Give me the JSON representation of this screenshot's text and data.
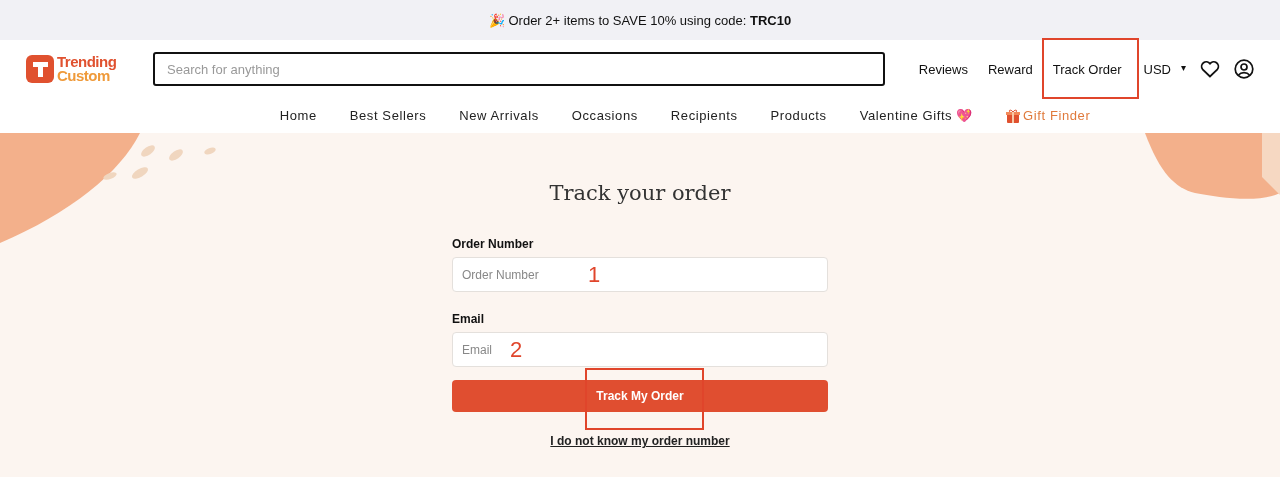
{
  "promo_banner": {
    "emoji": "🎉",
    "text": "Order 2+ items to SAVE 10% using code: **TRC10**"
  },
  "logo": {
    "line_1": "Trending",
    "line_2": "Custom"
  },
  "search": {
    "placeholder": "Search for anything"
  },
  "header_links": [
    {
      "label": "Reviews",
      "highlighted": false
    },
    {
      "label": "Reward",
      "highlighted": false
    },
    {
      "label": "Track Order",
      "highlighted": true
    }
  ],
  "currency": {
    "label": "USD",
    "caret": "▾"
  },
  "nav": [
    {
      "label": "Home",
      "kind": "plain"
    },
    {
      "label": "Best Sellers",
      "kind": "plain"
    },
    {
      "label": "New Arrivals",
      "kind": "plain"
    },
    {
      "label": "Occasions",
      "kind": "plain"
    },
    {
      "label": "Recipients",
      "kind": "plain"
    },
    {
      "label": "Products",
      "kind": "plain"
    },
    {
      "label": "Valentine Gifts 💖",
      "kind": "plain"
    },
    {
      "label": "Gift Finder",
      "kind": "gift"
    }
  ],
  "form": {
    "title": "Track your order",
    "fields": [
      {
        "label": "Order Number",
        "placeholder": "Order Number",
        "callout": "1"
      },
      {
        "label": "Email",
        "placeholder": "Email",
        "callout": "2"
      }
    ],
    "submit": {
      "label": "Track My Order",
      "highlighted": true
    },
    "help_link": "I do not know my order number"
  }
}
